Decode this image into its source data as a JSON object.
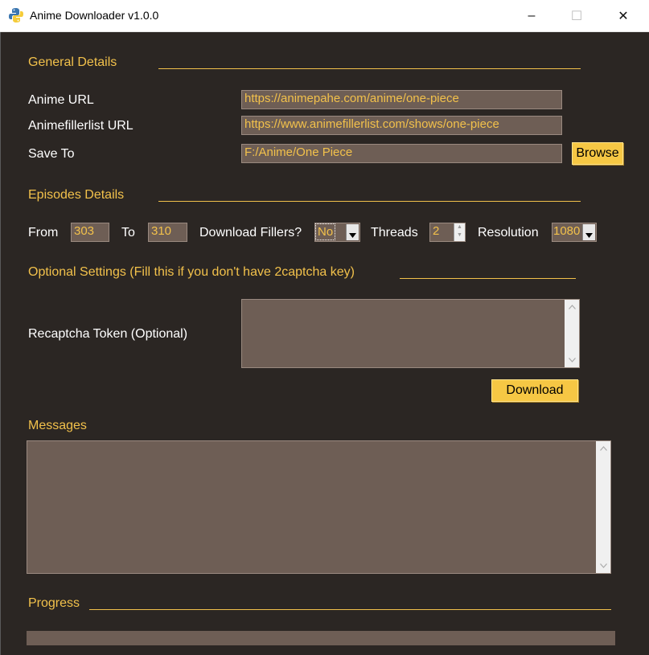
{
  "window": {
    "title": "Anime Downloader v1.0.0",
    "controls": {
      "minimize": "–",
      "maximize": "☐",
      "close": "✕"
    }
  },
  "general": {
    "heading": "General Details",
    "anime_url_label": "Anime URL",
    "anime_url_value": "https://animepahe.com/anime/one-piece",
    "filler_url_label": "Animefillerlist URL",
    "filler_url_value": "https://www.animefillerlist.com/shows/one-piece",
    "save_to_label": "Save To",
    "save_to_value": "F:/Anime/One Piece",
    "browse_label": "Browse"
  },
  "episodes": {
    "heading": "Episodes Details",
    "from_label": "From",
    "from_value": "303",
    "to_label": "To",
    "to_value": "310",
    "fillers_label": "Download Fillers?",
    "fillers_value": "No",
    "threads_label": "Threads",
    "threads_value": "2",
    "resolution_label": "Resolution",
    "resolution_value": "1080"
  },
  "optional": {
    "heading": "Optional Settings (Fill this if you don't have 2captcha key)",
    "recaptcha_label": "Recaptcha Token (Optional)",
    "recaptcha_value": "",
    "download_label": "Download"
  },
  "messages": {
    "heading": "Messages",
    "value": ""
  },
  "progress": {
    "heading": "Progress",
    "value": 0
  },
  "colors": {
    "accent": "#f2c14b",
    "background": "#2b2623",
    "field": "#6e5e55"
  }
}
